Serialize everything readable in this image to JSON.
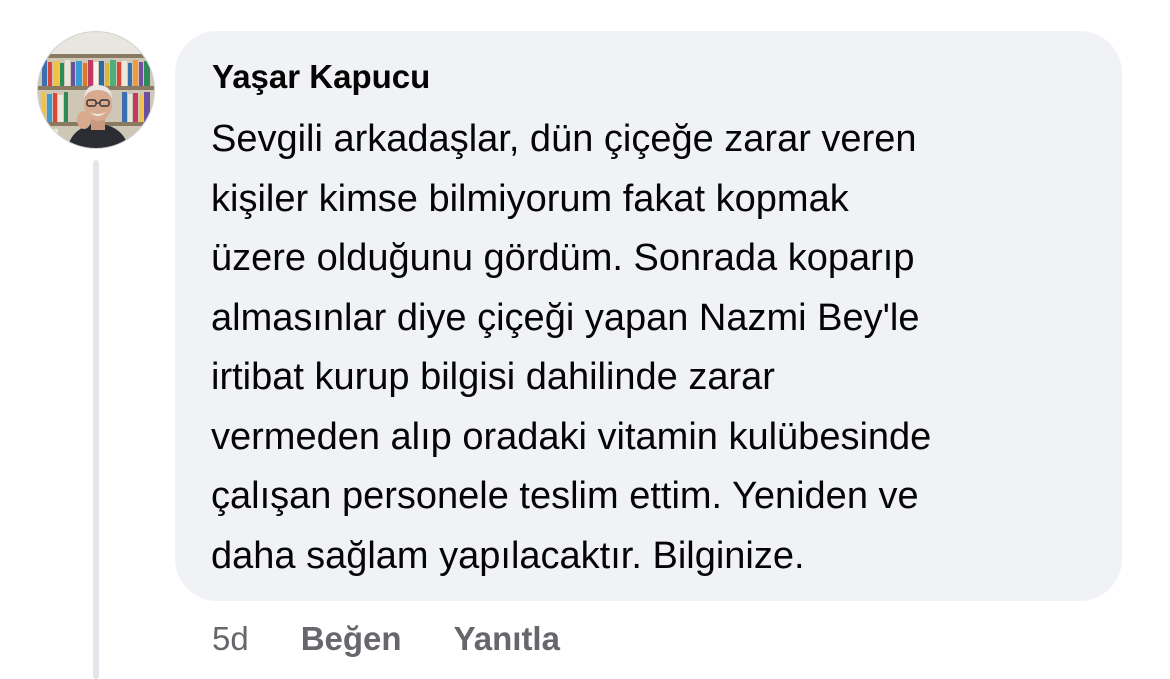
{
  "comment": {
    "author": "Yaşar Kapucu",
    "lines": [
      "Sevgili arkadaşlar, dün çiçeğe zarar veren",
      "kişiler kimse bilmiyorum fakat kopmak",
      "üzere olduğunu gördüm. Sonrada koparıp",
      "almasınlar diye çiçeği yapan Nazmi Bey'le",
      "irtibat kurup bilgisi dahilinde zarar",
      "vermeden alıp oradaki vitamin kulübesinde",
      "çalışan personele teslim ettim. Yeniden ve",
      "daha sağlam yapılacaktır. Bilginize."
    ],
    "timestamp": "5d",
    "like_label": "Beğen",
    "reply_label": "Yanıtla"
  },
  "colors": {
    "bubble_bg": "#f0f2f5",
    "text": "#050505",
    "secondary_text": "#65676b",
    "thread_line": "#e4e6eb"
  }
}
